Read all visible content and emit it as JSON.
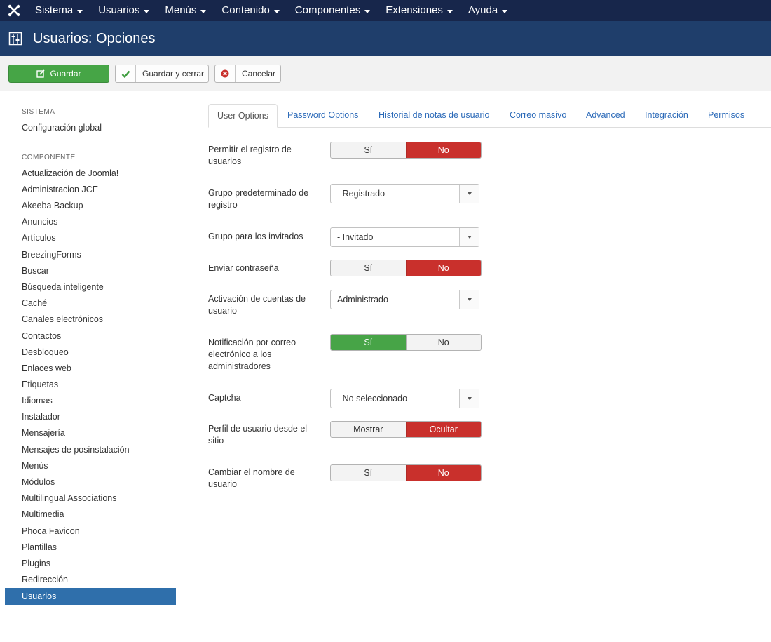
{
  "nav": {
    "menu": [
      "Sistema",
      "Usuarios",
      "Menús",
      "Contenido",
      "Componentes",
      "Extensiones",
      "Ayuda"
    ]
  },
  "header": {
    "title": "Usuarios: Opciones"
  },
  "toolbar": {
    "save": "Guardar",
    "save_close": "Guardar y cerrar",
    "cancel": "Cancelar"
  },
  "sidebar": {
    "system_heading": "SISTEMA",
    "global_config": "Configuración global",
    "component_heading": "COMPONENTE",
    "components": [
      "Actualización de Joomla!",
      "Administracion JCE",
      "Akeeba Backup",
      "Anuncios",
      "Artículos",
      "BreezingForms",
      "Buscar",
      "Búsqueda inteligente",
      "Caché",
      "Canales electrónicos",
      "Contactos",
      "Desbloqueo",
      "Enlaces web",
      "Etiquetas",
      "Idiomas",
      "Instalador",
      "Mensajería",
      "Mensajes de posinstalación",
      "Menús",
      "Módulos",
      "Multilingual Associations",
      "Multimedia",
      "Phoca Favicon",
      "Plantillas",
      "Plugins",
      "Redirección"
    ],
    "active": "Usuarios"
  },
  "tabs": [
    "User Options",
    "Password Options",
    "Historial de notas de usuario",
    "Correo masivo",
    "Advanced",
    "Integración",
    "Permisos"
  ],
  "form": {
    "allow_registration": {
      "label": "Permitir el registro de usuarios",
      "options": [
        "Sí",
        "No"
      ],
      "selected": "No"
    },
    "default_group": {
      "label": "Grupo predeterminado de registro",
      "value": "- Registrado"
    },
    "guest_group": {
      "label": "Grupo para los invitados",
      "value": "- Invitado"
    },
    "send_password": {
      "label": "Enviar contraseña",
      "options": [
        "Sí",
        "No"
      ],
      "selected": "No"
    },
    "activation": {
      "label": "Activación de cuentas de usuario",
      "value": "Administrado"
    },
    "admin_notification": {
      "label": "Notificación por correo electrónico a los administradores",
      "options": [
        "Sí",
        "No"
      ],
      "selected": "Sí"
    },
    "captcha": {
      "label": "Captcha",
      "value": "- No seleccionado -"
    },
    "frontend_profile": {
      "label": "Perfil de usuario desde el sitio",
      "options": [
        "Mostrar",
        "Ocultar"
      ],
      "selected": "Ocultar"
    },
    "change_username": {
      "label": "Cambiar el nombre de usuario",
      "options": [
        "Sí",
        "No"
      ],
      "selected": "No"
    }
  },
  "colors": {
    "navbar": "#17264b",
    "header": "#1f3e6b",
    "save_green": "#46a546",
    "toggle_red": "#c9302c",
    "link_blue": "#2a69b8",
    "active_blue": "#2f6fab"
  }
}
